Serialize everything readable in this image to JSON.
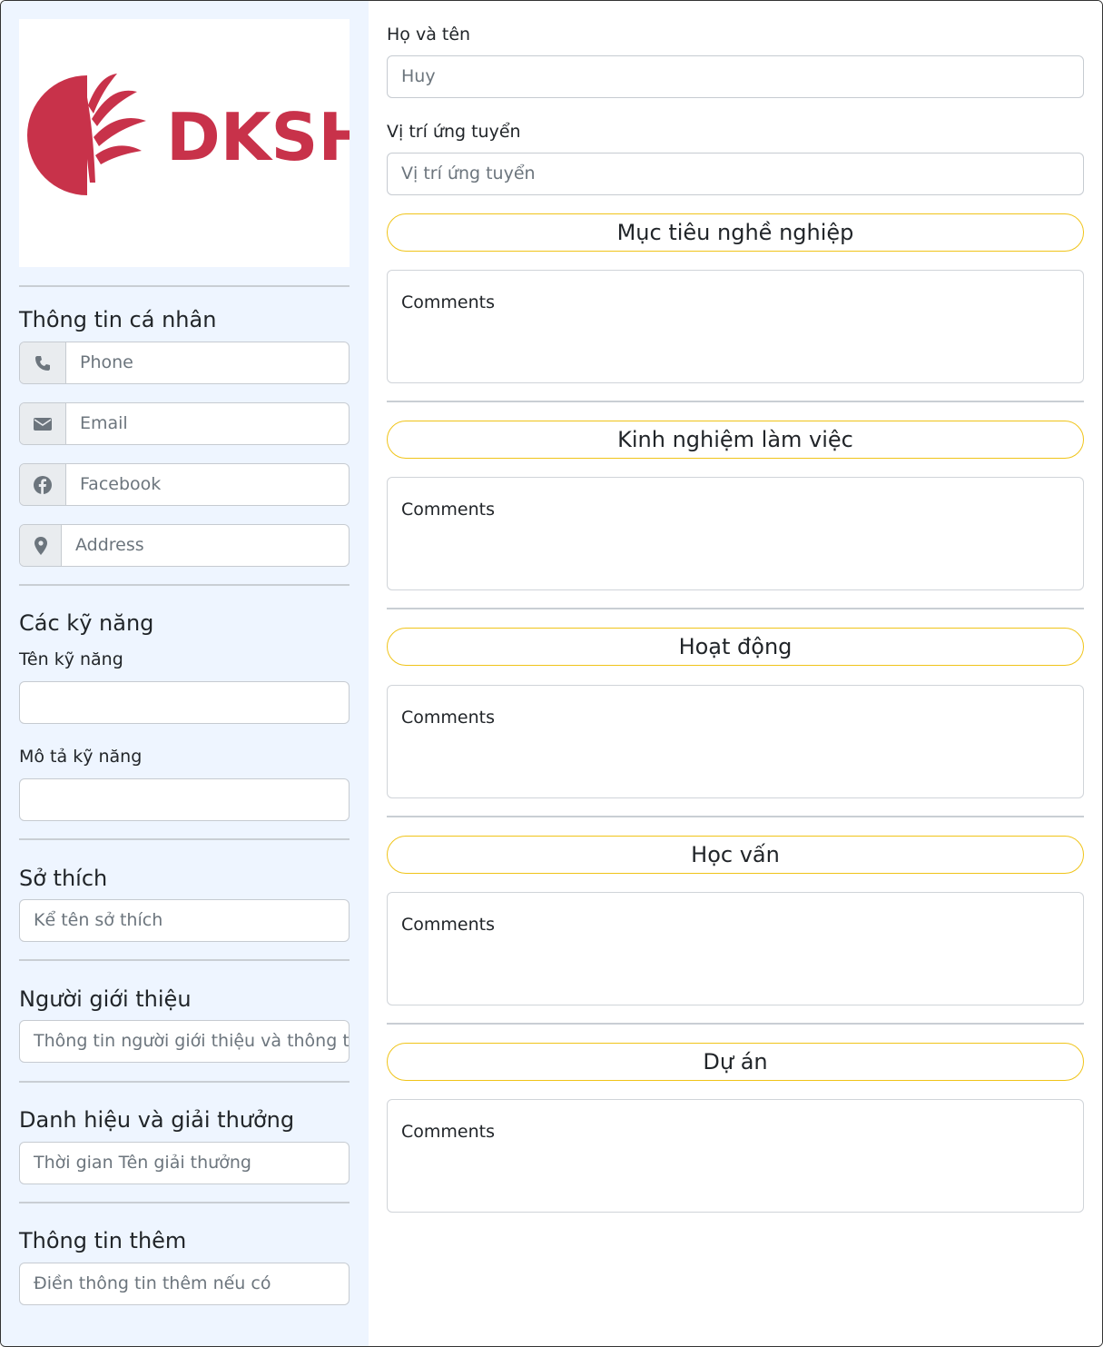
{
  "logo": {
    "text": "DKSH",
    "brand_color": "#c8324a"
  },
  "sidebar": {
    "personal": {
      "title": "Thông tin cá nhân",
      "phone_placeholder": "Phone",
      "email_placeholder": "Email",
      "facebook_placeholder": "Facebook",
      "address_placeholder": "Address",
      "icons": [
        "phone-icon",
        "envelope-icon",
        "facebook-icon",
        "map-marker-icon"
      ]
    },
    "skills": {
      "title": "Các kỹ năng",
      "name_label": "Tên kỹ năng",
      "desc_label": "Mô tả kỹ năng"
    },
    "hobbies": {
      "title": "Sở thích",
      "placeholder": "Kể tên sở thích"
    },
    "referrer": {
      "title": "Người giới thiệu",
      "placeholder": "Thông tin người giới thiệu và thông t"
    },
    "awards": {
      "title": "Danh hiệu và giải thưởng",
      "placeholder": "Thời gian  Tên giải thưởng"
    },
    "extra": {
      "title": "Thông tin thêm",
      "placeholder": "Điền thông tin thêm nếu có"
    }
  },
  "main": {
    "fullname": {
      "label": "Họ và tên",
      "value": "Huy"
    },
    "position": {
      "label": "Vị trí ứng tuyển",
      "placeholder": "Vị trí ứng tuyển"
    },
    "sections": [
      {
        "title": "Mục tiêu nghề nghiệp",
        "comment": "Comments"
      },
      {
        "title": "Kinh nghiệm làm việc",
        "comment": "Comments"
      },
      {
        "title": "Hoạt động",
        "comment": "Comments"
      },
      {
        "title": "Học vấn",
        "comment": "Comments"
      },
      {
        "title": "Dự án",
        "comment": "Comments"
      }
    ]
  },
  "colors": {
    "pill_border": "#f0c419",
    "sidebar_bg": "#eef5ff"
  }
}
